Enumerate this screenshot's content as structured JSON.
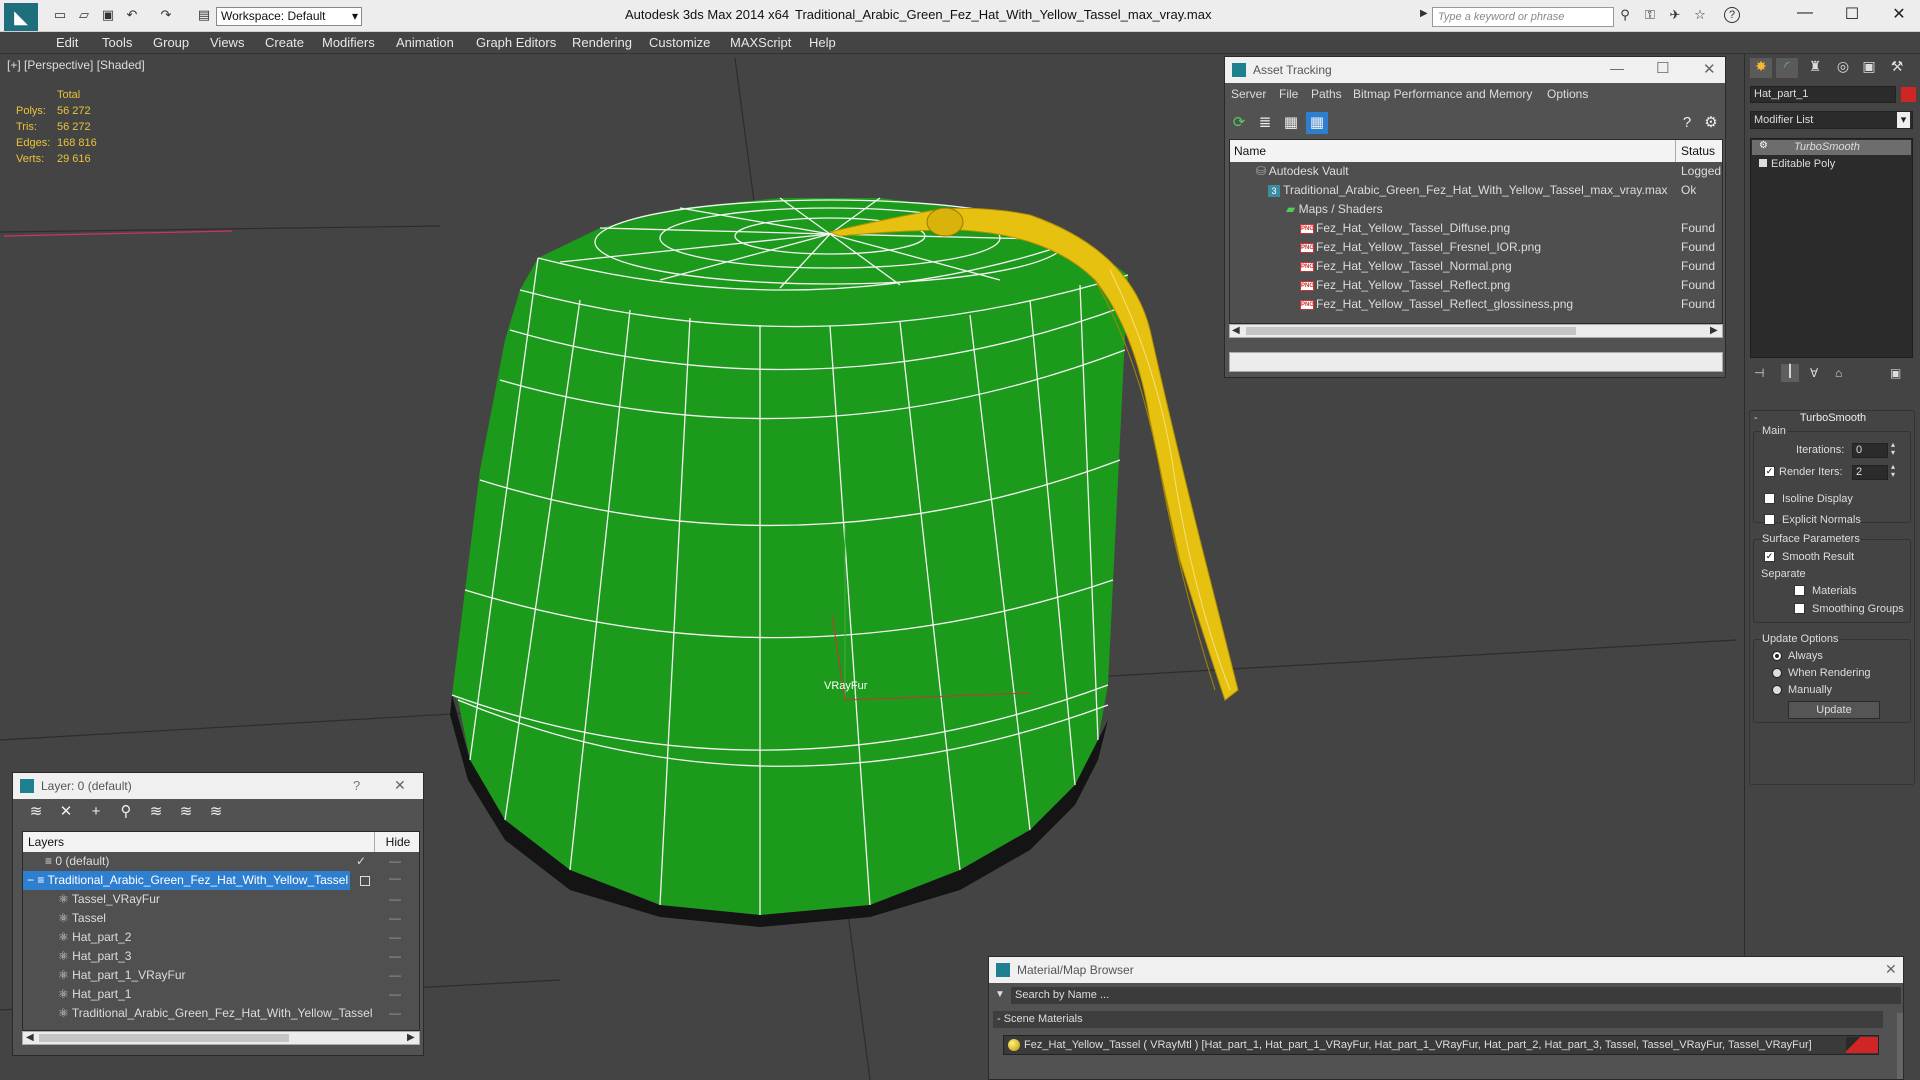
{
  "app": {
    "title": "Autodesk 3ds Max  2014 x64",
    "file": "Traditional_Arabic_Green_Fez_Hat_With_Yellow_Tassel_max_vray.max",
    "workspace": "Workspace: Default",
    "search_placeholder": "Type a keyword or phrase"
  },
  "menu": [
    "Edit",
    "Tools",
    "Group",
    "Views",
    "Create",
    "Modifiers",
    "Animation",
    "Graph Editors",
    "Rendering",
    "Customize",
    "MAXScript",
    "Help"
  ],
  "viewport": {
    "label": "[+] [Perspective] [Shaded]",
    "stats": {
      "header": "Total",
      "polys_label": "Polys:",
      "polys": "56 272",
      "tris_label": "Tris:",
      "tris": "56 272",
      "edges_label": "Edges:",
      "edges": "168 816",
      "verts_label": "Verts:",
      "verts": "29 616"
    },
    "object_label": "VRayFur"
  },
  "asset_tracking": {
    "title": "Asset Tracking",
    "menu": [
      "Server",
      "File",
      "Paths",
      "Bitmap Performance and Memory",
      "Options"
    ],
    "col_name": "Name",
    "col_status": "Status",
    "rows": [
      {
        "name": "Autodesk Vault",
        "status": "Logged O"
      },
      {
        "name": "Traditional_Arabic_Green_Fez_Hat_With_Yellow_Tassel_max_vray.max",
        "status": "Ok"
      },
      {
        "name": "Maps / Shaders",
        "status": ""
      },
      {
        "name": "Fez_Hat_Yellow_Tassel_Diffuse.png",
        "status": "Found"
      },
      {
        "name": "Fez_Hat_Yellow_Tassel_Fresnel_IOR.png",
        "status": "Found"
      },
      {
        "name": "Fez_Hat_Yellow_Tassel_Normal.png",
        "status": "Found"
      },
      {
        "name": "Fez_Hat_Yellow_Tassel_Reflect.png",
        "status": "Found"
      },
      {
        "name": "Fez_Hat_Yellow_Tassel_Reflect_glossiness.png",
        "status": "Found"
      }
    ],
    "png_glyph": "PNG"
  },
  "layer_panel": {
    "title": "Layer: 0 (default)",
    "help": "?",
    "col_layers": "Layers",
    "col_hide": "Hide",
    "rows": [
      "0 (default)",
      "Traditional_Arabic_Green_Fez_Hat_With_Yellow_Tassel",
      "Tassel_VRayFur",
      "Tassel",
      "Hat_part_2",
      "Hat_part_3",
      "Hat_part_1_VRayFur",
      "Hat_part_1",
      "Traditional_Arabic_Green_Fez_Hat_With_Yellow_Tassel"
    ]
  },
  "material_browser": {
    "title": "Material/Map Browser",
    "search_placeholder": "Search by Name ...",
    "section": "- Scene Materials",
    "material": "Fez_Hat_Yellow_Tassel  ( VRayMtl ) [Hat_part_1, Hat_part_1_VRayFur, Hat_part_1_VRayFur, Hat_part_2, Hat_part_3, Tassel, Tassel_VRayFur, Tassel_VRayFur]"
  },
  "command_panel": {
    "object_name": "Hat_part_1",
    "modifier_list": "Modifier List",
    "stack": [
      "TurboSmooth",
      "Editable Poly"
    ],
    "rollout_title": "TurboSmooth",
    "main": "Main",
    "iterations_label": "Iterations:",
    "iterations": "0",
    "render_iters_label": "Render Iters:",
    "render_iters": "2",
    "isoline": "Isoline Display",
    "explicit_normals": "Explicit Normals",
    "surface_params": "Surface Parameters",
    "smooth_result": "Smooth Result",
    "separate": "Separate",
    "materials": "Materials",
    "smoothing_groups": "Smoothing Groups",
    "update_options": "Update Options",
    "always": "Always",
    "when_rendering": "When Rendering",
    "manually": "Manually",
    "update": "Update"
  },
  "colors": {
    "hat_green": "#1fa51f",
    "tassel_yellow": "#e6c10f",
    "stats_yellow": "#e9c33a",
    "selection_blue": "#2f7fd1",
    "object_color": "#d02525"
  }
}
